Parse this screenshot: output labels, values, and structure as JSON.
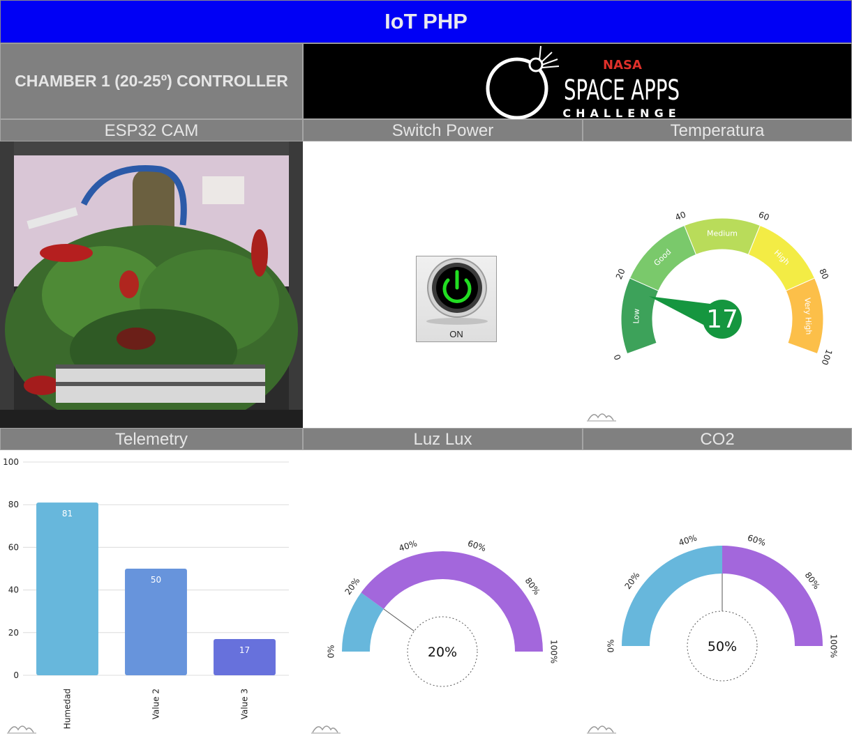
{
  "header": {
    "title": "IoT PHP"
  },
  "controller": {
    "label": "CHAMBER 1 (20-25º) CONTROLLER"
  },
  "logo": {
    "nasa": "NASA",
    "space_apps": "SPACE APPS",
    "challenge": "CHALLENGE"
  },
  "panels": {
    "cam": "ESP32 CAM",
    "switch": "Switch Power",
    "temp": "Temperatura",
    "telemetry": "Telemetry",
    "lux": "Luz Lux",
    "co2": "CO2"
  },
  "switch": {
    "state_label": "ON"
  },
  "temperature_gauge": {
    "value": 17,
    "value_label": "17",
    "min": 0,
    "max": 100,
    "ticks": [
      "0",
      "20",
      "40",
      "60",
      "80",
      "100"
    ],
    "bands": [
      {
        "label": "Low",
        "from": 0,
        "to": 20,
        "color": "#3da25a"
      },
      {
        "label": "Good",
        "from": 20,
        "to": 40,
        "color": "#7ac96b"
      },
      {
        "label": "Medium",
        "from": 40,
        "to": 60,
        "color": "#b9dc5a"
      },
      {
        "label": "High",
        "from": 60,
        "to": 80,
        "color": "#f3ec45"
      },
      {
        "label": "Very High",
        "from": 80,
        "to": 100,
        "color": "#fcbf49"
      }
    ],
    "needle_color": "#15963f"
  },
  "lux_gauge": {
    "value": 20,
    "value_label": "20%",
    "ticks": [
      "0%",
      "20%",
      "40%",
      "60%",
      "80%",
      "100%"
    ],
    "fill_color": "#67b7dc",
    "rest_color": "#a367dc"
  },
  "co2_gauge": {
    "value": 50,
    "value_label": "50%",
    "ticks": [
      "0%",
      "20%",
      "40%",
      "60%",
      "80%",
      "100%"
    ],
    "fill_color": "#67b7dc",
    "rest_color": "#a367dc"
  },
  "chart_data": {
    "type": "bar",
    "categories": [
      "Humedad",
      "Value 2",
      "Value 3"
    ],
    "values": [
      81,
      50,
      17
    ],
    "colors": [
      "#67b7dc",
      "#6794dc",
      "#6771dc"
    ],
    "ylim": [
      0,
      100
    ],
    "yticks": [
      "0",
      "20",
      "40",
      "60",
      "80",
      "100"
    ],
    "title": "",
    "xlabel": "",
    "ylabel": "",
    "grid": true
  }
}
